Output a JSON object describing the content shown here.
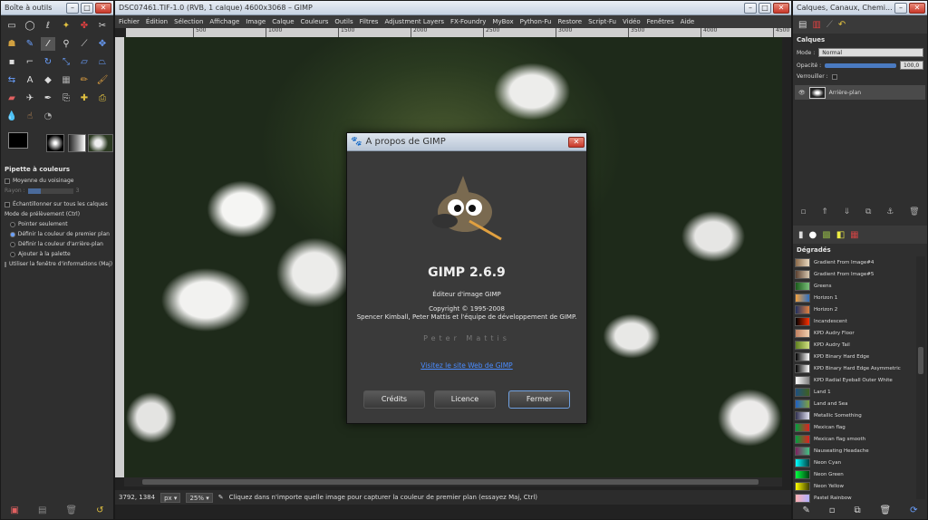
{
  "toolbox": {
    "title": "Boîte à outils",
    "tool_options_title": "Pipette à couleurs",
    "sample_average": "Moyenne du voisinage",
    "radius_label": "Rayon :",
    "radius_value": "3",
    "sample_merged": "Échantillonner sur tous les calques",
    "pick_mode": "Mode de prélèvement (Ctrl)",
    "mode_options": [
      "Pointer seulement",
      "Définir la couleur de premier plan",
      "Définir la couleur d'arrière-plan",
      "Ajouter à la palette"
    ],
    "use_info_window": "Utiliser la fenêtre d'informations (Maj)"
  },
  "main": {
    "title": "DSC07461.TIF-1.0 (RVB, 1 calque) 4600x3068 – GIMP",
    "menu": [
      "Fichier",
      "Édition",
      "Sélection",
      "Affichage",
      "Image",
      "Calque",
      "Couleurs",
      "Outils",
      "Filtres",
      "Adjustment Layers",
      "FX-Foundry",
      "MyBox",
      "Python-Fu",
      "Restore",
      "Script-Fu",
      "Vidéo",
      "Fenêtres",
      "Aide"
    ],
    "ruler_ticks": [
      "500",
      "1000",
      "1500",
      "2000",
      "2500",
      "3000",
      "3500",
      "4000",
      "4500"
    ],
    "status": {
      "coords": "3792, 1384",
      "unit": "px",
      "zoom": "25%",
      "message": "Cliquez dans n'importe quelle image pour capturer la couleur de premier plan (essayez Maj, Ctrl)"
    }
  },
  "about": {
    "title": "À propos de GIMP",
    "version": "GIMP 2.6.9",
    "subtitle": "Éditeur d'image GIMP",
    "copyright": "Copyright © 1995-2008",
    "authors": "Spencer Kimball, Peter Mattis et l'équipe de développement de GIMP.",
    "credits_name": "Peter Mattis",
    "link": "Visitez le site Web de GIMP",
    "btn_credits": "Crédits",
    "btn_licence": "Licence",
    "btn_close": "Fermer"
  },
  "layers": {
    "title": "Calques, Canaux, Chemi...",
    "section": "Calques",
    "mode_label": "Mode :",
    "mode_value": "Normal",
    "opacity_label": "Opacité :",
    "opacity_value": "100,0",
    "lock_label": "Verrouiller :",
    "layer_name": "Arrière-plan",
    "gradients_title": "Dégradés",
    "gradients": [
      {
        "name": "Gradient From Image#4",
        "colors": [
          "#8a6a4a",
          "#e8d8c0"
        ]
      },
      {
        "name": "Gradient From Image#5",
        "colors": [
          "#5a4030",
          "#d8c8b0"
        ]
      },
      {
        "name": "Greens",
        "colors": [
          "#1a5a1a",
          "#7ac07a"
        ]
      },
      {
        "name": "Horizon 1",
        "colors": [
          "#f0a040",
          "#3070c0"
        ]
      },
      {
        "name": "Horizon 2",
        "colors": [
          "#203060",
          "#e08040"
        ]
      },
      {
        "name": "Incandescent",
        "colors": [
          "#000000",
          "#ff3000"
        ]
      },
      {
        "name": "KPD Audry Floor",
        "colors": [
          "#c08060",
          "#f0d0b0"
        ]
      },
      {
        "name": "KPD Audry Tail",
        "colors": [
          "#608020",
          "#d0e080"
        ]
      },
      {
        "name": "KPD Binary Hard Edge",
        "colors": [
          "#000000",
          "#ffffff"
        ]
      },
      {
        "name": "KPD Binary Hard Edge Asymmetric",
        "colors": [
          "#000000",
          "#ffffff"
        ]
      },
      {
        "name": "KPD Radial Eyeball Outer White",
        "colors": [
          "#ffffff",
          "#808080"
        ]
      },
      {
        "name": "Land 1",
        "colors": [
          "#205080",
          "#406020"
        ]
      },
      {
        "name": "Land and Sea",
        "colors": [
          "#2060c0",
          "#80a040"
        ]
      },
      {
        "name": "Metallic Something",
        "colors": [
          "#303050",
          "#e0e0f0"
        ]
      },
      {
        "name": "Mexican flag",
        "colors": [
          "#00a040",
          "#e02020"
        ]
      },
      {
        "name": "Mexican flag smooth",
        "colors": [
          "#00a040",
          "#e02020"
        ]
      },
      {
        "name": "Nauseating Headache",
        "colors": [
          "#802060",
          "#40c080"
        ]
      },
      {
        "name": "Neon Cyan",
        "colors": [
          "#00ffff",
          "#004040"
        ]
      },
      {
        "name": "Neon Green",
        "colors": [
          "#00ff40",
          "#004010"
        ]
      },
      {
        "name": "Neon Yellow",
        "colors": [
          "#ffff00",
          "#404000"
        ]
      },
      {
        "name": "Pastel Rainbow",
        "colors": [
          "#ffb0b0",
          "#b0b0ff"
        ]
      }
    ]
  },
  "colors": {
    "accent": "#4a8cff",
    "dialog_bg": "#3a3a3a",
    "panel_bg": "#2f2f2f"
  }
}
